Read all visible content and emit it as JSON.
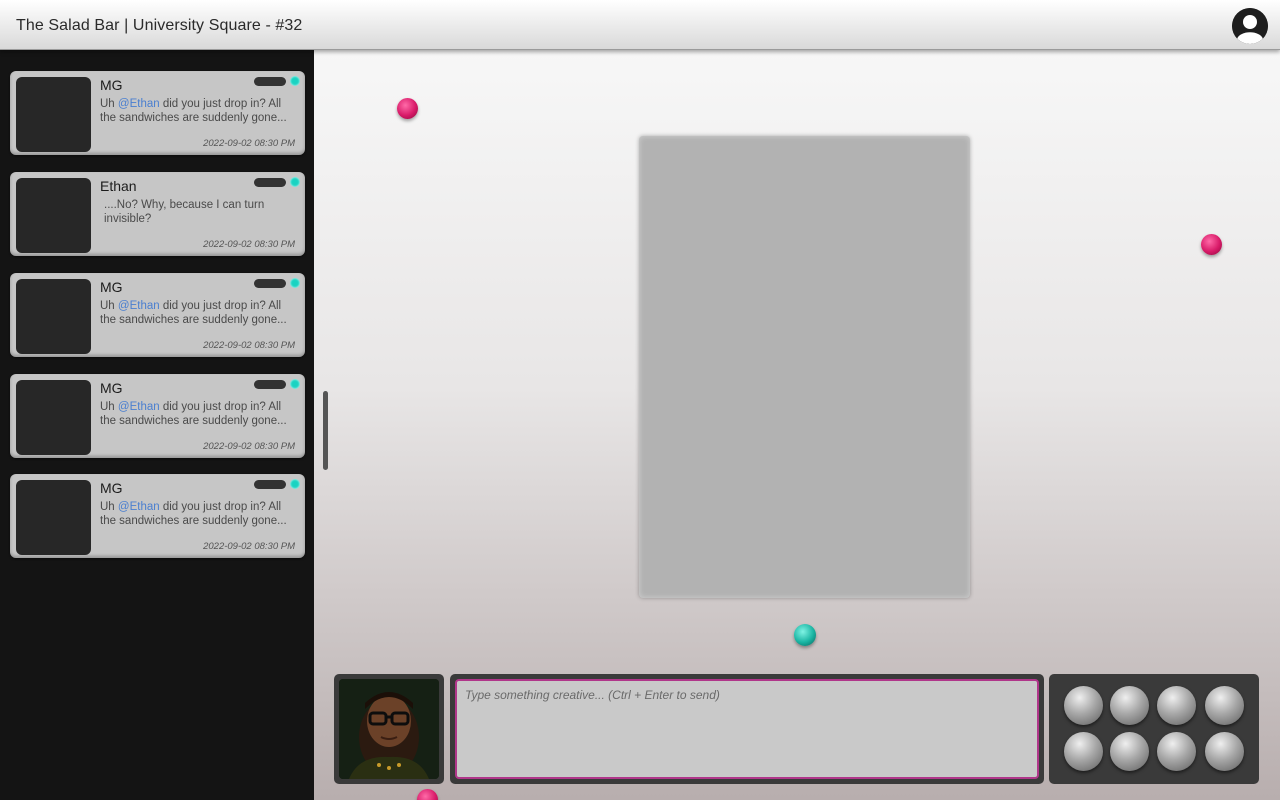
{
  "header": {
    "title": "The Salad Bar | University Square - #32",
    "profile_icon": "user-icon"
  },
  "messages": [
    {
      "name": "MG",
      "pre": "Uh ",
      "mention": "@Ethan",
      "post": " did you just drop in? All the sandwiches are suddenly gone...",
      "time": "2022-09-02 08:30 PM"
    },
    {
      "name": "Ethan",
      "pre": "....No? Why, because I can turn invisible?",
      "mention": "",
      "post": "",
      "time": "2022-09-02 08:30 PM"
    },
    {
      "name": "MG",
      "pre": "Uh ",
      "mention": "@Ethan",
      "post": " did you just drop in? All the sandwiches are suddenly gone...",
      "time": "2022-09-02 08:30 PM"
    },
    {
      "name": "MG",
      "pre": "Uh ",
      "mention": "@Ethan",
      "post": " did you just drop in? All the sandwiches are suddenly gone...",
      "time": "2022-09-02 08:30 PM"
    },
    {
      "name": "MG",
      "pre": "Uh ",
      "mention": "@Ethan",
      "post": " did you just drop in? All the sandwiches are suddenly gone...",
      "time": "2022-09-02 08:30 PM"
    }
  ],
  "composer": {
    "placeholder": "Type something creative... (Ctrl + Enter to send)",
    "value": ""
  },
  "colors": {
    "accent_pink": "#d81a68",
    "accent_teal": "#19b4a2",
    "status_online": "#19d3c2",
    "mention": "#4a7fd0",
    "input_border": "#b0368a"
  },
  "action_buttons_count": 8
}
